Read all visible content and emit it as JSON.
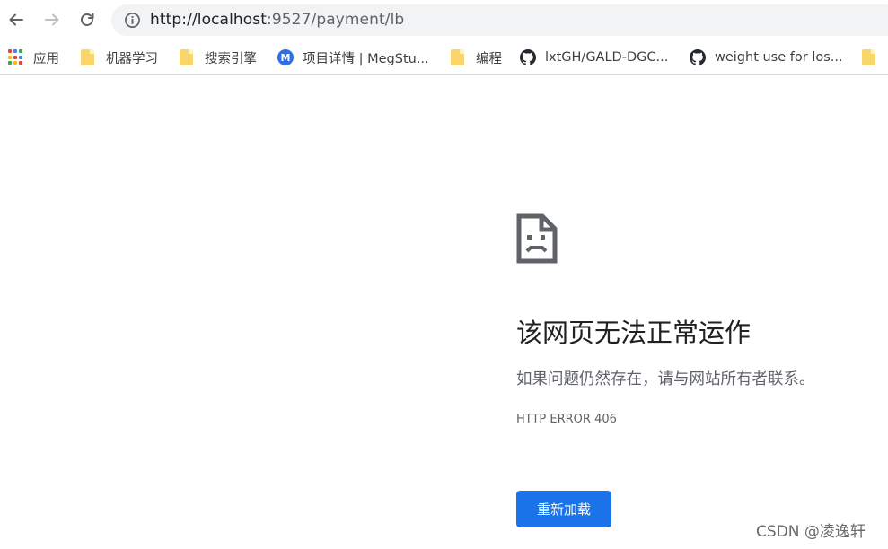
{
  "toolbar": {
    "url_host": "http://localhost",
    "url_rest": ":9527/payment/lb"
  },
  "bookmarks": [
    {
      "label": "应用",
      "icon": "apps-grid-icon"
    },
    {
      "label": "机器学习",
      "icon": "folder-icon"
    },
    {
      "label": "搜索引擎",
      "icon": "folder-icon"
    },
    {
      "label": "项目详情 | MegStu...",
      "icon": "megstudio-icon",
      "badge": "M"
    },
    {
      "label": "编程",
      "icon": "folder-icon"
    },
    {
      "label": "lxtGH/GALD-DGC...",
      "icon": "github-icon"
    },
    {
      "label": "weight use for los...",
      "icon": "github-icon"
    }
  ],
  "error": {
    "heading": "该网页无法正常运作",
    "description": "如果问题仍然存在，请与网站所有者联系。",
    "code": "HTTP ERROR 406",
    "reload_label": "重新加载"
  },
  "watermark": "CSDN @凌逸轩",
  "colors": {
    "accent": "#1a73e8",
    "folder": "#f9d66b",
    "text_secondary": "#5f6368"
  }
}
